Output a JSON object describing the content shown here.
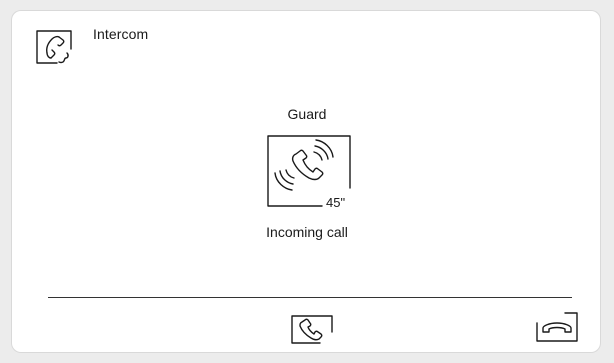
{
  "header": {
    "title": "Intercom",
    "icon": "intercom-handset-icon"
  },
  "call": {
    "caller_name": "Guard",
    "status": "Incoming call",
    "timer": "45\"",
    "icon": "ringing-phone-icon"
  },
  "actions": {
    "answer_icon": "answer-call-icon",
    "hangup_icon": "hang-up-icon"
  },
  "colors": {
    "background": "#ececec",
    "screen": "#ffffff",
    "foreground": "#1a1a1a"
  }
}
